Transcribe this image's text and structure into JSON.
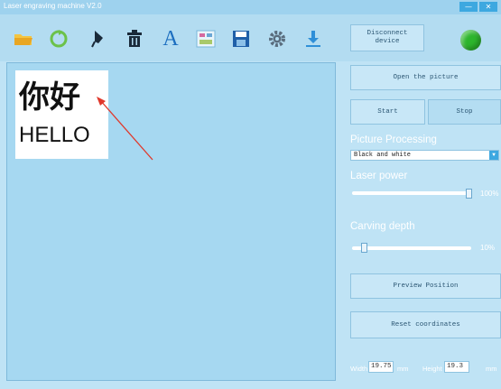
{
  "window": {
    "title": "Laser engraving machine V2.0",
    "min_glyph": "—",
    "close_glyph": "✕"
  },
  "toolbar": {
    "icons": [
      "open-folder-icon",
      "refresh-icon",
      "pen-icon",
      "trash-icon",
      "text-icon",
      "image-icon",
      "save-icon",
      "gear-icon",
      "download-icon"
    ],
    "text_glyph": "A",
    "disconnect_label": "Disconnect\ndevice",
    "status_color": "#2db52d"
  },
  "canvas": {
    "chinese_text": "你好",
    "english_text": "HELLO"
  },
  "panel": {
    "open_picture_label": "Open the picture",
    "start_label": "Start",
    "stop_label": "Stop",
    "picture_processing_label": "Picture Processing",
    "processing_value": "Black and white",
    "laser_power_label": "Laser power",
    "laser_power_value": "100%",
    "laser_power_level": 1.0,
    "carving_depth_label": "Carving depth",
    "carving_depth_value": "10%",
    "carving_depth_level": 0.1,
    "preview_position_label": "Preview Position",
    "reset_coordinates_label": "Reset coordinates",
    "width_label": "Width",
    "width_value": "19.75",
    "width_unit": "mm",
    "height_label": "Height",
    "height_value": "19.3",
    "height_unit": "mm"
  },
  "colors": {
    "accent": "#3da8e0",
    "background": "#bfe3f5",
    "canvas": "#a6d8f1",
    "arrow": "#e0382b"
  }
}
